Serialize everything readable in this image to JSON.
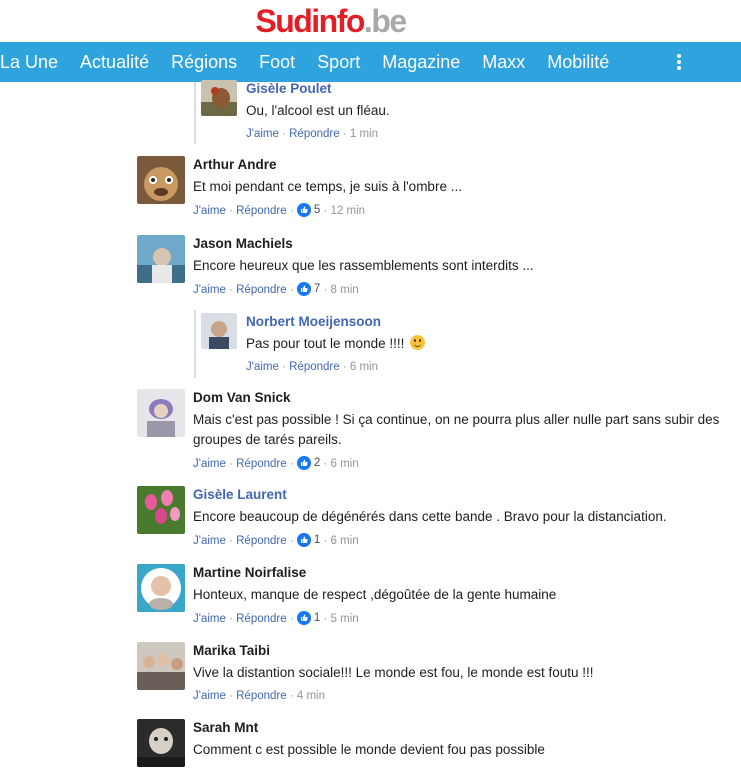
{
  "site": {
    "logo_part1": "Sud",
    "logo_part2": "info",
    "logo_part3": ".be"
  },
  "nav": [
    {
      "label": "La Une"
    },
    {
      "label": "Actualité"
    },
    {
      "label": "Régions"
    },
    {
      "label": "Foot"
    },
    {
      "label": "Sport"
    },
    {
      "label": "Magazine"
    },
    {
      "label": "Maxx"
    },
    {
      "label": "Mobilité"
    }
  ],
  "actions": {
    "like": "J'aime",
    "reply": "Répondre",
    "sep": "·"
  },
  "comments": [
    {
      "name": "Gisèle Poulet",
      "text": "Ou, l'alcool est un fléau.",
      "likes": "",
      "time": "1 min"
    },
    {
      "name": "Arthur Andre",
      "text": "Et moi pendant ce temps, je suis à l'ombre ...",
      "likes": "5",
      "time": "12 min"
    },
    {
      "name": "Jason Machiels",
      "text": "Encore heureux que les rassemblements sont interdits ...",
      "likes": "7",
      "time": "8 min"
    },
    {
      "name": "Norbert Moeijensoon",
      "text": "Pas pour tout le monde !!!!",
      "likes": "",
      "time": "6 min"
    },
    {
      "name": "Dom Van Snick",
      "text": "Mais c'est pas possible ! Si ça continue, on ne pourra plus aller nulle part sans subir des groupes de tarés pareils.",
      "likes": "2",
      "time": "6 min"
    },
    {
      "name": "Gisèle Laurent",
      "text": "Encore beaucoup de dégénérés dans cette bande . Bravo pour la distanciation.",
      "likes": "1",
      "time": "6 min"
    },
    {
      "name": "Martine Noirfalise",
      "text": "Honteux, manque de respect ,dégoûtée de la gente humaine",
      "likes": "1",
      "time": "5 min"
    },
    {
      "name": "Marika Taibi",
      "text": "Vive la distantion sociale!!! Le monde est fou, le monde est foutu !!!",
      "likes": "",
      "time": "4 min"
    },
    {
      "name": "Sarah Mnt",
      "text": "Comment c est possible le monde devient fou pas possible",
      "likes": "",
      "time": ""
    }
  ]
}
